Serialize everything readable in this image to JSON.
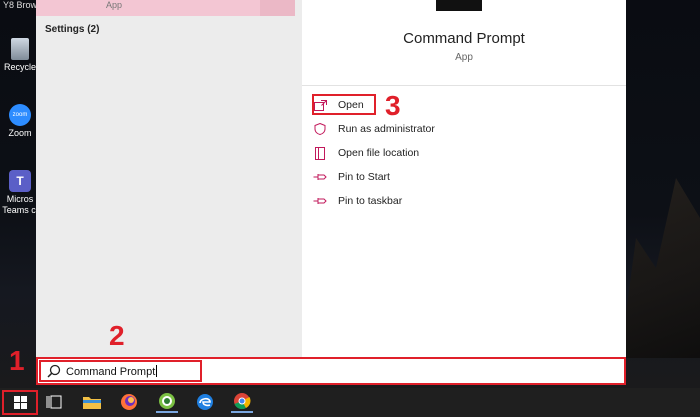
{
  "desktop": {
    "top_label": "Y8 Brow",
    "icons": [
      {
        "label": "Recycle",
        "icon": "recycle-bin-icon"
      },
      {
        "label": "Zoom",
        "icon": "zoom-icon",
        "glyph": "zoom"
      },
      {
        "label": "Micros Teams cl",
        "icon": "teams-icon",
        "glyph": "T"
      }
    ]
  },
  "start_menu": {
    "left_pane": {
      "top_item_subtitle": "App",
      "settings_header": "Settings (2)"
    },
    "right_pane": {
      "app_name": "Command Prompt",
      "app_type": "App",
      "actions": [
        {
          "label": "Open",
          "icon": "open-window-icon"
        },
        {
          "label": "Run as administrator",
          "icon": "admin-shield-icon"
        },
        {
          "label": "Open file location",
          "icon": "file-location-icon"
        },
        {
          "label": "Pin to Start",
          "icon": "pin-icon"
        },
        {
          "label": "Pin to taskbar",
          "icon": "pin-icon"
        }
      ]
    }
  },
  "search": {
    "value": "Command Prompt",
    "icon": "search-icon"
  },
  "taskbar": {
    "items": [
      "start-button",
      "task-view-icon",
      "file-explorer-icon",
      "firefox-icon",
      "cocCoc-icon",
      "edge-icon",
      "chrome-icon"
    ]
  },
  "annotations": {
    "step1": "1",
    "step2": "2",
    "step3": "3"
  },
  "colors": {
    "highlight_red": "#e0202a",
    "accent_pink": "#c2185b",
    "taskbar": "#1f1f1f"
  }
}
